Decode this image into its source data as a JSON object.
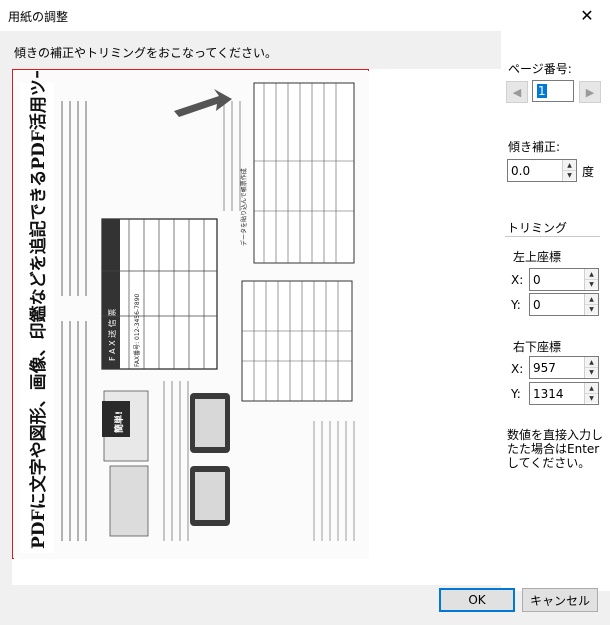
{
  "window": {
    "title": "用紙の調整",
    "close_glyph": "✕"
  },
  "instruction": "傾きの補正やトリミングをおこなってください。",
  "page": {
    "label": "ページ番号:",
    "value": "1"
  },
  "tilt": {
    "label": "傾き補正:",
    "value": "0.0",
    "unit": "度"
  },
  "trimming": {
    "label": "トリミング",
    "top_left": {
      "label": "左上座標",
      "x_label": "X:",
      "x": "0",
      "y_label": "Y:",
      "y": "0"
    },
    "bottom_right": {
      "label": "右下座標",
      "x_label": "X:",
      "x": "957",
      "y_label": "Y:",
      "y": "1314"
    }
  },
  "note": "数値を直接入力したた場合はEnterしてください。",
  "buttons": {
    "ok": "OK",
    "cancel": "キャンセル"
  },
  "scan_text": {
    "headline": "PDFに文字や図形、画像、印鑑などを追記できるPDF活用ツールです。",
    "fax_title": "F A X 送 信 票",
    "fax_number": "FAX番号: 012-3456-7890",
    "simple": "簡単!",
    "callout": "データを貼り込んで帳票作成"
  },
  "colors": {
    "crop_border": "#d81b1b",
    "accent": "#0078d7"
  }
}
